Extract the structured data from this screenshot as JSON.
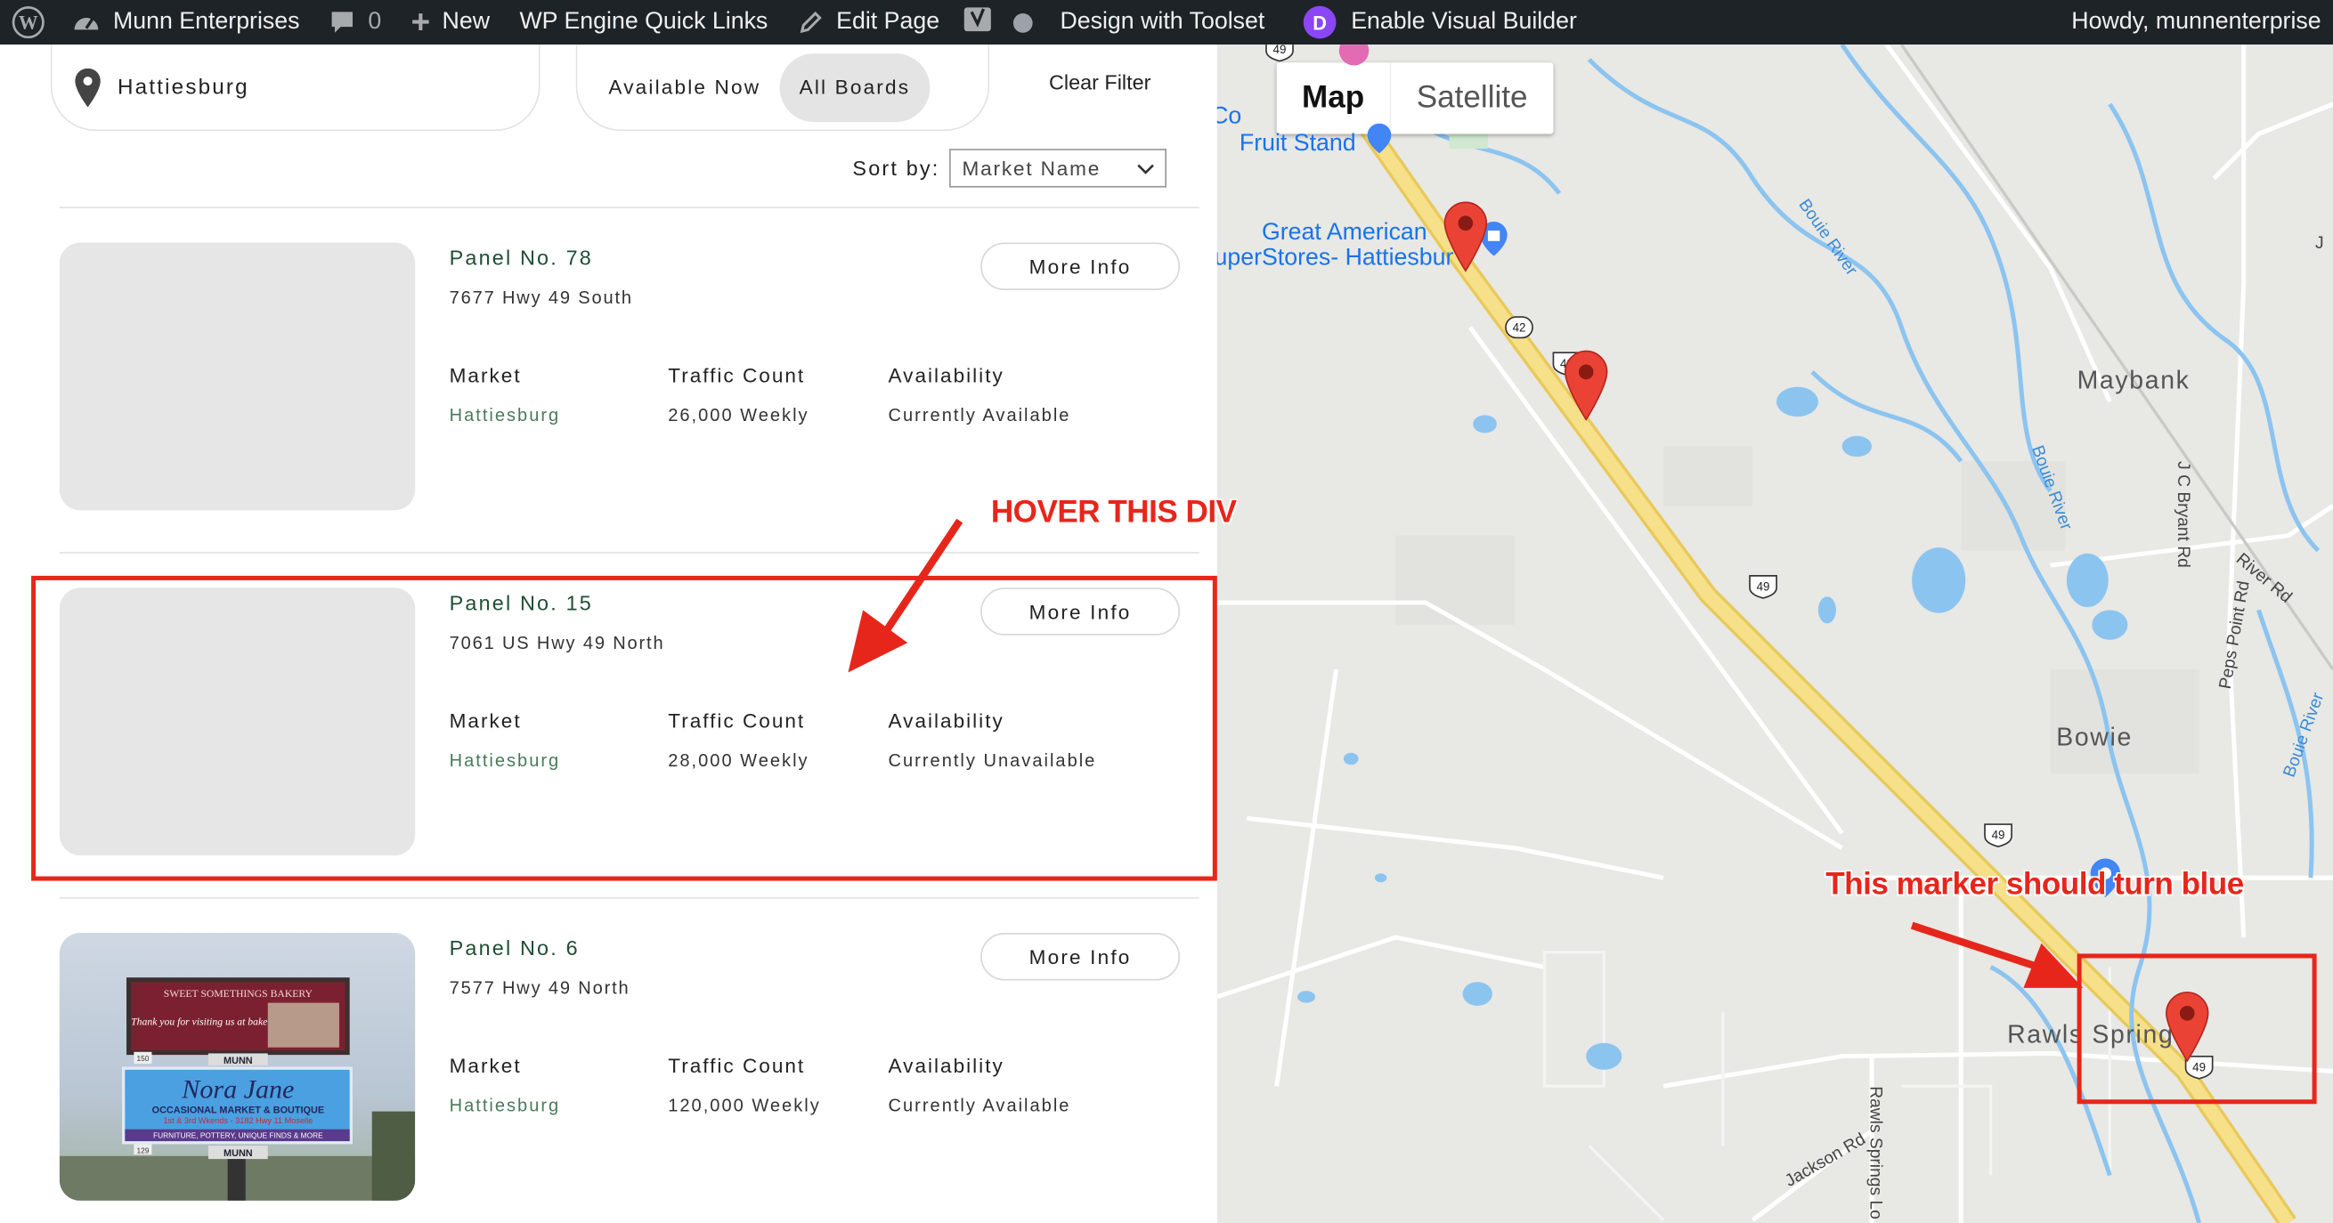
{
  "admin_bar": {
    "site_name": "Munn Enterprises",
    "comments_count": "0",
    "new_label": "New",
    "quick_links": "WP Engine Quick Links",
    "edit_page": "Edit Page",
    "toolset": "Design with Toolset",
    "visual_builder": "Enable Visual Builder",
    "greeting": "Howdy, munnenterprise"
  },
  "filters": {
    "location": "Hattiesburg",
    "toggle": [
      "Available Now",
      "All Boards"
    ],
    "active_toggle": "All Boards",
    "clear_filter": "Clear Filter",
    "sort_label": "Sort by:",
    "sort_value": "Market Name"
  },
  "columns": {
    "market": "Market",
    "traffic": "Traffic Count",
    "availability": "Availability"
  },
  "more_info_label": "More Info",
  "panels": [
    {
      "title": "Panel No. 78",
      "address": "7677 Hwy 49 South",
      "market": "Hattiesburg",
      "traffic": "26,000 Weekly",
      "availability": "Currently Available"
    },
    {
      "title": "Panel No. 15",
      "address": "7061 US Hwy 49 North",
      "market": "Hattiesburg",
      "traffic": "28,000 Weekly",
      "availability": "Currently Unavailable"
    },
    {
      "title": "Panel No. 6",
      "address": "7577 Hwy 49 North",
      "market": "Hattiesburg",
      "traffic": "120,000 Weekly",
      "availability": "Currently Available"
    }
  ],
  "billboard": {
    "top_sign": "SWEET SOMETHINGS BAKERY",
    "top_sign_line2": "Thank you for visiting us at bakery!",
    "brand": "MUNN",
    "bottom_sign": "Nora Jane",
    "bottom_sign_line2": "OCCASIONAL MARKET & BOUTIQUE",
    "bottom_sign_line3": "1st & 3rd Wkends - 3182 Hwy 11 Moselle",
    "bottom_sign_line4": "FURNITURE, POTTERY, UNIQUE FINDS & MORE",
    "panel_num_top": "150",
    "panel_num_bottom": "129"
  },
  "annotations": {
    "hover": "HOVER THIS DIV",
    "marker": "This marker should turn blue"
  },
  "map": {
    "type_buttons": [
      "Map",
      "Satellite"
    ],
    "active_type": "Map",
    "places": {
      "maybank": "Maybank",
      "bowie": "Bowie",
      "rawls": "Rawls Springs",
      "fruit_stand": "Fruit Stand",
      "great_american_1": "Great American",
      "great_american_2": "uperStores- Hattiesbur",
      "co": "Co"
    },
    "roads": {
      "jc_bryant": "J C Bryant Rd",
      "peps_point": "Peps Point Rd",
      "river_rd": "River Rd",
      "jackson": "Jackson Rd",
      "rawls_springs_lo": "Rawls Springs Lo",
      "j": "J"
    },
    "rivers": {
      "bouie1": "Bouie River",
      "bouie2": "Bouie River",
      "bouie3": "Bouie River"
    },
    "shields": [
      "49",
      "42",
      "49",
      "49",
      "49",
      "49"
    ],
    "colors": {
      "marker": "#ea4335",
      "highway": "#f5d76e",
      "water": "#8cc4f0",
      "land": "#e8e8e5"
    }
  }
}
